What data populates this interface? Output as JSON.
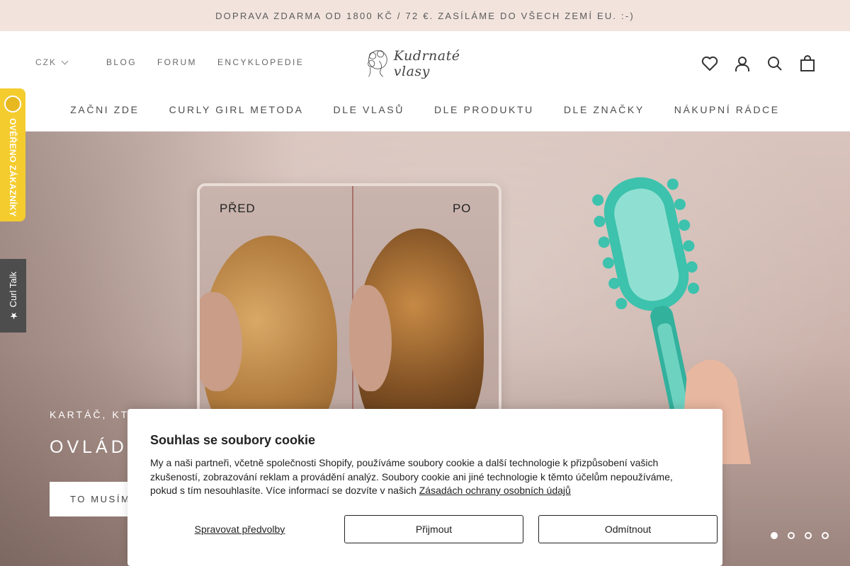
{
  "announcement": "DOPRAVA ZDARMA OD 1800 KČ / 72 €. ZASÍLÁME DO VŠECH ZEMÍ EU. :-)",
  "currency": "CZK",
  "topnav": [
    "BLOG",
    "FORUM",
    "ENCYKLOPEDIE"
  ],
  "logo_text": "Kudrnaté vlasy",
  "icons": {
    "wishlist": "heart-icon",
    "account": "user-icon",
    "search": "search-icon",
    "cart": "shopping-bag-icon"
  },
  "mainnav": [
    "ZAČNI ZDE",
    "CURLY GIRL METODA",
    "DLE VLASŮ",
    "DLE PRODUKTU",
    "DLE ZNAČKY",
    "NÁKUPNÍ RÁDCE"
  ],
  "hero": {
    "label_before": "PŘED",
    "label_after": "PO",
    "pretitle": "KARTÁČ, KTER",
    "title": "OVLÁDL",
    "button": "TO MUSÍM"
  },
  "slider": {
    "count": 4,
    "active": 1
  },
  "side_tabs": {
    "verified": "OVĚŘENO ZÁKAZNÍKY",
    "curl_talk": "★ Curl Talk"
  },
  "cookie": {
    "title": "Souhlas se soubory cookie",
    "text": "My a naši partneři, včetně společnosti Shopify, používáme soubory cookie a další technologie k přizpůsobení vašich zkušeností, zobrazování reklam a provádění analýz. Soubory cookie ani jiné technologie k těmto účelům nepoužíváme, pokud s tím nesouhlasíte. Více informací se dozvíte v našich",
    "link": "Zásadách ochrany osobních údajů",
    "manage": "Spravovat předvolby",
    "accept": "Přijmout",
    "decline": "Odmítnout"
  },
  "colors": {
    "announcement_bg": "#f2e4dd",
    "verified_badge": "#f4cc2e",
    "curl_talk_tab": "#4d4d4d",
    "brush": "#3cc2ad"
  }
}
